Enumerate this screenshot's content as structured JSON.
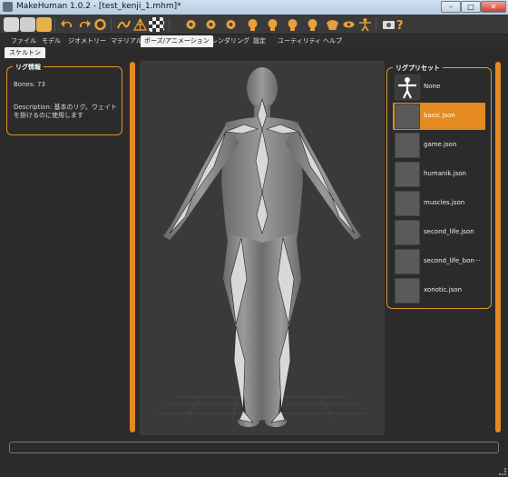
{
  "window": {
    "title": "MakeHuman 1.0.2 - [test_kenji_1.mhm]*",
    "minimize": "–",
    "maximize": "□",
    "close": "✕"
  },
  "toolbar": {
    "icons": [
      "new-icon",
      "save-icon",
      "export-icon",
      "undo-icon",
      "redo-icon",
      "reset-icon",
      "smooth-icon",
      "wireframe-icon",
      "background-icon",
      "front-view-icon",
      "back-view-icon",
      "left-view-icon",
      "right-view-icon",
      "top-view-icon",
      "bottom-view-icon",
      "reset-camera-icon",
      "pose-icon",
      "screenshot-icon",
      "help-icon"
    ]
  },
  "tabs": [
    {
      "label": "ファイル",
      "active": false
    },
    {
      "label": "モデル",
      "active": false
    },
    {
      "label": "ジオメトリー",
      "active": false
    },
    {
      "label": "マテリアル",
      "active": false
    },
    {
      "label": "ポーズ/アニメーション",
      "active": true
    },
    {
      "label": "レンダリング",
      "active": false
    },
    {
      "label": "設定",
      "active": false
    },
    {
      "label": "ユーティリティ",
      "active": false
    },
    {
      "label": "ヘルプ",
      "active": false
    }
  ],
  "subtab": {
    "label": "スケルトン"
  },
  "rig_info": {
    "title": "リグ情報",
    "bones": "Bones: 73",
    "description": "Description: 基本のリグ。ウェイトを掛けるのに使用します"
  },
  "rig_presets": {
    "title": "リグプリセット",
    "items": [
      {
        "label": "None",
        "selected": false
      },
      {
        "label": "basic.json",
        "selected": true
      },
      {
        "label": "game.json",
        "selected": false
      },
      {
        "label": "humanik.json",
        "selected": false
      },
      {
        "label": "muscles.json",
        "selected": false
      },
      {
        "label": "second_life.json",
        "selected": false
      },
      {
        "label": "second_life_bon···",
        "selected": false
      },
      {
        "label": "xonotic.json",
        "selected": false
      }
    ]
  },
  "colors": {
    "accent": "#e48a1e",
    "panel_bg": "#2b2b2b",
    "viewport_bg": "#3a3a3a"
  }
}
